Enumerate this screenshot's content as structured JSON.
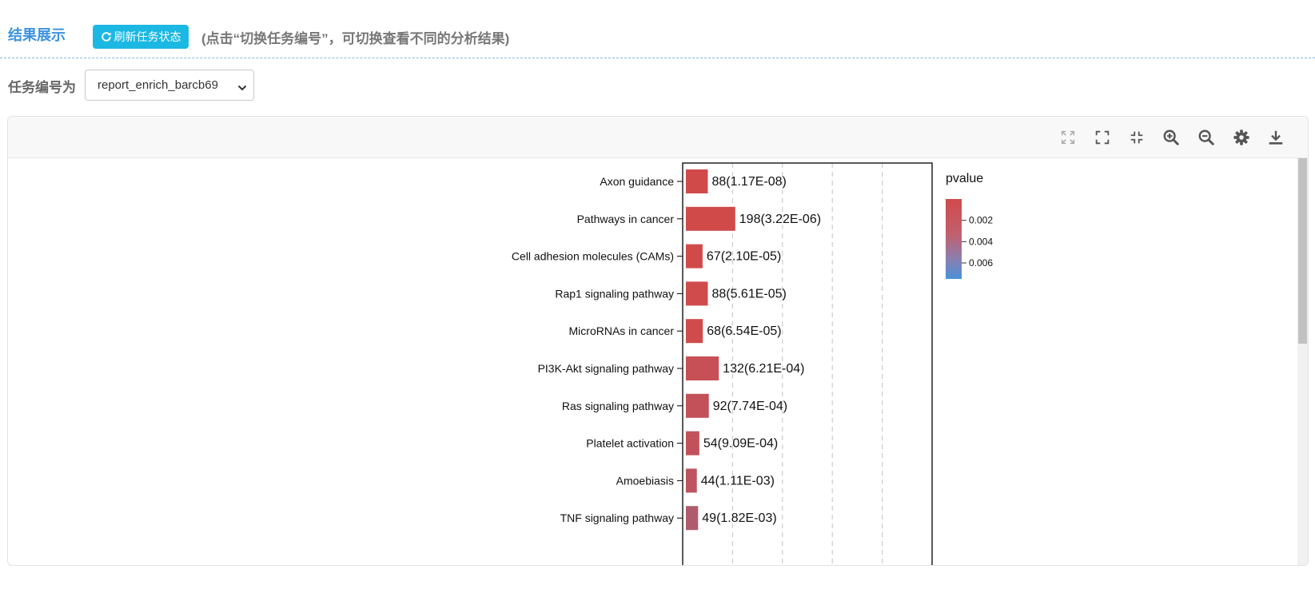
{
  "header": {
    "title": "结果展示",
    "refresh_label": "刷新任务状态",
    "hint": "(点击“切换任务编号”，可切换查看不同的分析结果)"
  },
  "task": {
    "label": "任务编号为",
    "selected": "report_enrich_barcb69"
  },
  "toolbar": {
    "icons": [
      "expand-icon",
      "fullscreen-icon",
      "compress-icon",
      "zoom-in-icon",
      "zoom-out-icon",
      "settings-icon",
      "download-icon"
    ]
  },
  "colors": {
    "accent": "#3b93e0",
    "button": "#1bb8e3",
    "bar_high": "#d14a4a",
    "bar_low": "#4a90d9"
  },
  "chart_data": {
    "type": "bar",
    "orientation": "horizontal",
    "categories": [
      "Axon guidance",
      "Pathways in cancer",
      "Cell adhesion molecules (CAMs)",
      "Rap1 signaling pathway",
      "MicroRNAs in cancer",
      "PI3K-Akt signaling pathway",
      "Ras signaling pathway",
      "Platelet activation",
      "Amoebiasis",
      "TNF signaling pathway"
    ],
    "values": [
      88,
      198,
      67,
      88,
      68,
      132,
      92,
      54,
      44,
      49
    ],
    "pvalues": [
      1.17e-08,
      3.22e-06,
      2.1e-05,
      5.61e-05,
      6.54e-05,
      0.000621,
      0.000774,
      0.000909,
      0.00111,
      0.00182
    ],
    "data_labels": [
      "88(1.17E-08)",
      "198(3.22E-06)",
      "67(2.10E-05)",
      "88(5.61E-05)",
      "68(6.54E-05)",
      "132(6.21E-04)",
      "92(7.74E-04)",
      "54(9.09E-04)",
      "44(1.11E-03)",
      "49(1.82E-03)"
    ],
    "xlim": [
      0,
      1000
    ],
    "grid": true,
    "legend": {
      "title": "pvalue",
      "ticks": [
        "0.002",
        "0.004",
        "0.006"
      ],
      "tick_values": [
        0.002,
        0.004,
        0.006
      ],
      "range": [
        0,
        0.0075
      ],
      "placement": "right"
    }
  }
}
